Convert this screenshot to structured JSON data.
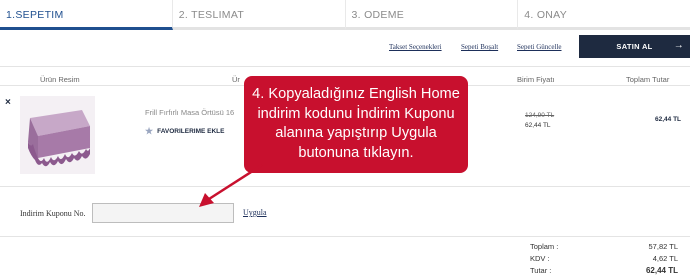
{
  "steps": [
    {
      "label": "1.SEPETIM"
    },
    {
      "label": "2. TESLIMAT"
    },
    {
      "label": "3. ODEME"
    },
    {
      "label": "4. ONAY"
    }
  ],
  "actions": {
    "link1": "Takset Seçenekleri",
    "link2": "Sepeti Boşalt",
    "link3": "Sepeti Güncelle",
    "buy": "SATIN AL",
    "buy_icon": "→"
  },
  "table": {
    "col_image": "Ürün Resim",
    "col_name": "Ür",
    "col_unit": "Birim Fiyatı",
    "col_total": "Toplam Tutar"
  },
  "product": {
    "remove": "×",
    "name": "Frill Fırfırlı Masa Örtüsü 16",
    "favorite": "FAVORILERIME EKLE",
    "old_price": "124,90 TL",
    "new_price": "62,44 TL",
    "total": "62,44 TL"
  },
  "coupon": {
    "label": "Indirim Kuponu No.",
    "value": "",
    "apply": "Uygula"
  },
  "summary": {
    "subtotal_label": "Toplam :",
    "subtotal": "57,82 TL",
    "kdv_label": "KDV :",
    "kdv": "4,62 TL",
    "total_label": "Tutar :",
    "total": "62,44 TL"
  },
  "callout": {
    "text": "4. Kopyaladığınız English Home indirim kodunu İndirim Kuponu alanına yapıştırıp Uygula butonuna tıklayın."
  },
  "colors": {
    "accent": "#1e2a40",
    "active_step": "#1f4f8f",
    "callout": "#c8102e"
  }
}
